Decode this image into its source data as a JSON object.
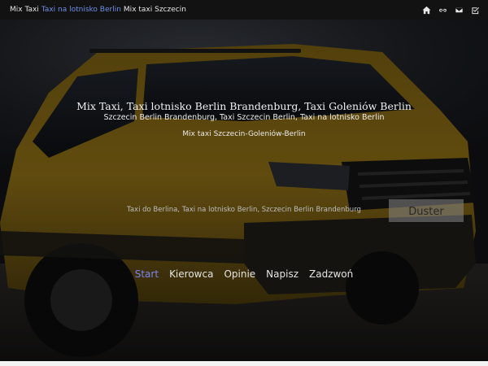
{
  "topbar": {
    "crumb1": "Mix Taxi",
    "crumb2": "Taxi na lotnisko Berlin",
    "crumb3": "Mix taxi Szczecin",
    "icons": [
      "home-icon",
      "link-icon",
      "mail-icon",
      "checkbox-icon"
    ]
  },
  "hero": {
    "title": "Mix Taxi, Taxi lotnisko Berlin Brandenburg, Taxi Goleniów Berlin",
    "subtitle": "Szczecin Berlin Brandenburg, Taxi Szczecin Berlin, Taxi na lotnisko Berlin",
    "tagline": "Mix taxi Szczecin-Goleniów-Berlin",
    "keywords": "Taxi do Berlina, Taxi na lotnisko Berlin, Szczecin Berlin Brandenburg",
    "badge": "Duster"
  },
  "nav": [
    {
      "label": "Start",
      "active": true
    },
    {
      "label": "Kierowca",
      "active": false
    },
    {
      "label": "Opinie",
      "active": false
    },
    {
      "label": "Napisz",
      "active": false
    },
    {
      "label": "Zadzwoń",
      "active": false
    }
  ],
  "colors": {
    "accent": "#7b86f0",
    "link": "#6f8fe8",
    "car": "#8a6a14"
  }
}
